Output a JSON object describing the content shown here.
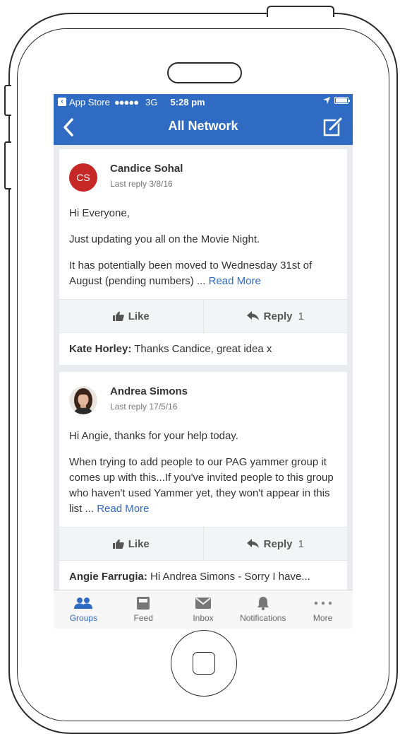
{
  "status_bar": {
    "back_app": "App Store",
    "signal": "●●●●●",
    "network": "3G",
    "time": "5:28 pm"
  },
  "nav": {
    "title": "All Network"
  },
  "posts": [
    {
      "avatar_initials": "CS",
      "author": "Candice Sohal",
      "meta": "Last reply 3/8/16",
      "paragraphs": [
        "Hi Everyone,",
        "Just updating you all on the Movie Night.",
        "It has potentially been moved to Wednesday 31st of August (pending numbers) ..."
      ],
      "read_more": "Read More",
      "like_label": "Like",
      "reply_label": "Reply",
      "reply_count": "1",
      "latest_reply_author": "Kate Horley:",
      "latest_reply_text": "Thanks Candice, great idea x"
    },
    {
      "author": "Andrea Simons",
      "meta": "Last reply 17/5/16",
      "paragraphs": [
        "Hi Angie, thanks for your help today.",
        "When trying to add people to our PAG yammer group it comes up with this...If you've invited people to this group who haven't used Yammer yet, they won't appear in this list ..."
      ],
      "read_more": "Read More",
      "like_label": "Like",
      "reply_label": "Reply",
      "reply_count": "1",
      "latest_reply_author": "Angie Farrugia:",
      "latest_reply_text": "Hi Andrea Simons - Sorry I have..."
    }
  ],
  "tabs": [
    {
      "label": "Groups",
      "icon": "groups-icon",
      "active": true
    },
    {
      "label": "Feed",
      "icon": "feed-icon",
      "active": false
    },
    {
      "label": "Inbox",
      "icon": "inbox-icon",
      "active": false
    },
    {
      "label": "Notifications",
      "icon": "bell-icon",
      "active": false
    },
    {
      "label": "More",
      "icon": "more-icon",
      "active": false
    }
  ],
  "colors": {
    "brand_blue": "#2f6bc2",
    "avatar_red": "#c62828"
  }
}
